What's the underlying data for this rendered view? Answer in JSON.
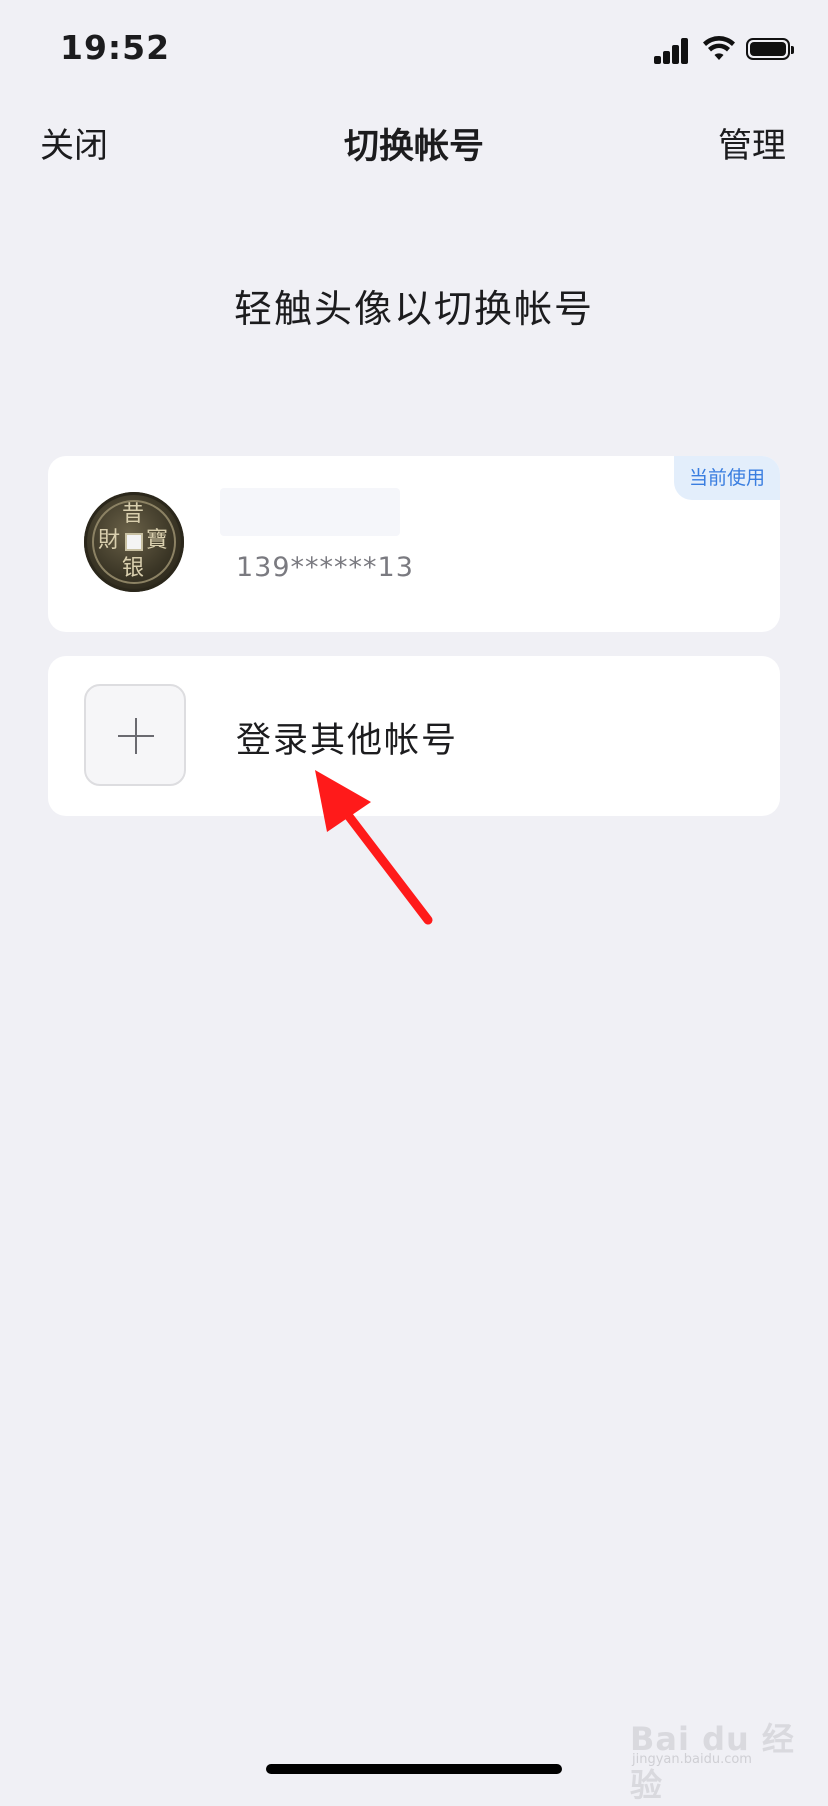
{
  "status_bar": {
    "time": "19:52",
    "icons": [
      "signal-icon",
      "wifi-icon",
      "battery-icon"
    ]
  },
  "nav": {
    "close_label": "关闭",
    "title": "切换帐号",
    "manage_label": "管理"
  },
  "hint": "轻触头像以切换帐号",
  "current_account": {
    "badge": "当前使用",
    "phone": "139******13",
    "avatar": "coin-avatar"
  },
  "add_account": {
    "label": "登录其他帐号",
    "icon": "plus-icon"
  },
  "annotation": {
    "color": "#ff1a1a",
    "icon": "red-arrow-icon"
  },
  "watermark": {
    "text": "Bai du 经验",
    "sub": "jingyan.baidu.com"
  }
}
